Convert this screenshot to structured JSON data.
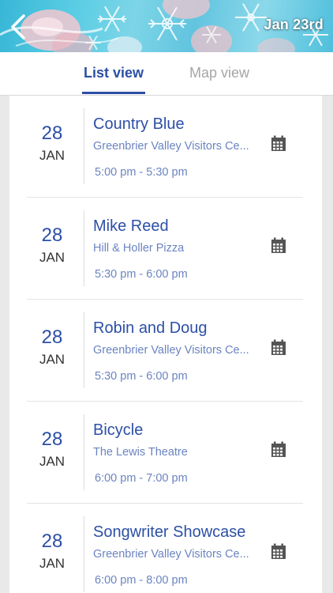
{
  "header": {
    "date": "Jan 23rd",
    "back_icon": "chevron-left-icon"
  },
  "tabs": [
    {
      "label": "List view",
      "active": true
    },
    {
      "label": "Map view",
      "active": false
    }
  ],
  "events": [
    {
      "day": "28",
      "month": "JAN",
      "title": "Country Blue",
      "venue": "Greenbrier Valley Visitors Ce...",
      "time": "5:00 pm - 5:30 pm"
    },
    {
      "day": "28",
      "month": "JAN",
      "title": "Mike Reed",
      "venue": "Hill & Holler Pizza",
      "time": "5:30 pm - 6:00 pm"
    },
    {
      "day": "28",
      "month": "JAN",
      "title": "Robin and Doug",
      "venue": "Greenbrier Valley Visitors Ce...",
      "time": "5:30 pm - 6:00 pm"
    },
    {
      "day": "28",
      "month": "JAN",
      "title": "Bicycle",
      "venue": "The Lewis Theatre",
      "time": "6:00 pm - 7:00 pm"
    },
    {
      "day": "28",
      "month": "JAN",
      "title": "Songwriter Showcase",
      "venue": "Greenbrier Valley Visitors Ce...",
      "time": "6:00 pm - 8:00 pm"
    }
  ],
  "colors": {
    "accent": "#2c4fa6",
    "secondary_text": "#6a84c0",
    "inactive_tab": "#a6a6a6",
    "background": "#e9e9e9"
  },
  "icons": {
    "event_action": "calendar-icon"
  }
}
